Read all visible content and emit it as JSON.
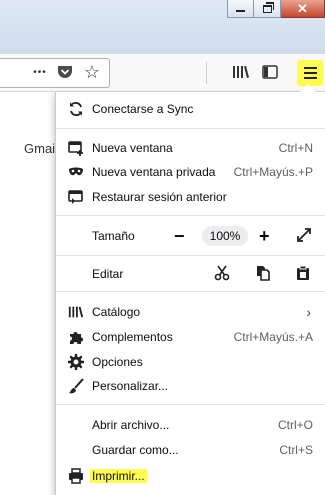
{
  "window": {
    "minimize_glyph": "",
    "close_glyph": "✕"
  },
  "toolbar": {
    "more_actions": "•••",
    "pocket_icon": "pocket-icon",
    "bookmark_star": "☆",
    "library_icon": "library-icon",
    "sidebar_icon": "sidebar-icon",
    "hamburger_icon": "hamburger-menu-icon"
  },
  "page": {
    "partial_text": "Gmai"
  },
  "menu": {
    "sync": {
      "label": "Conectarse a Sync"
    },
    "new_window": {
      "label": "Nueva ventana",
      "shortcut": "Ctrl+N"
    },
    "private_window": {
      "label": "Nueva ventana privada",
      "shortcut": "Ctrl+Mayús.+P"
    },
    "restore_session": {
      "label": "Restaurar sesión anterior"
    },
    "zoom": {
      "label": "Tamaño",
      "minus": "−",
      "value": "100%",
      "plus": "+"
    },
    "edit": {
      "label": "Editar"
    },
    "library": {
      "label": "Catálogo"
    },
    "addons": {
      "label": "Complementos",
      "shortcut": "Ctrl+Mayús.+A"
    },
    "options": {
      "label": "Opciones"
    },
    "customize": {
      "label": "Personalizar..."
    },
    "open_file": {
      "label": "Abrir archivo...",
      "shortcut": "Ctrl+O"
    },
    "save_as": {
      "label": "Guardar como...",
      "shortcut": "Ctrl+S"
    },
    "print": {
      "label": "Imprimir..."
    }
  },
  "colors": {
    "highlight": "#fffc4f",
    "titlebar": "#dfe9f5",
    "close_button": "#c7462c"
  }
}
